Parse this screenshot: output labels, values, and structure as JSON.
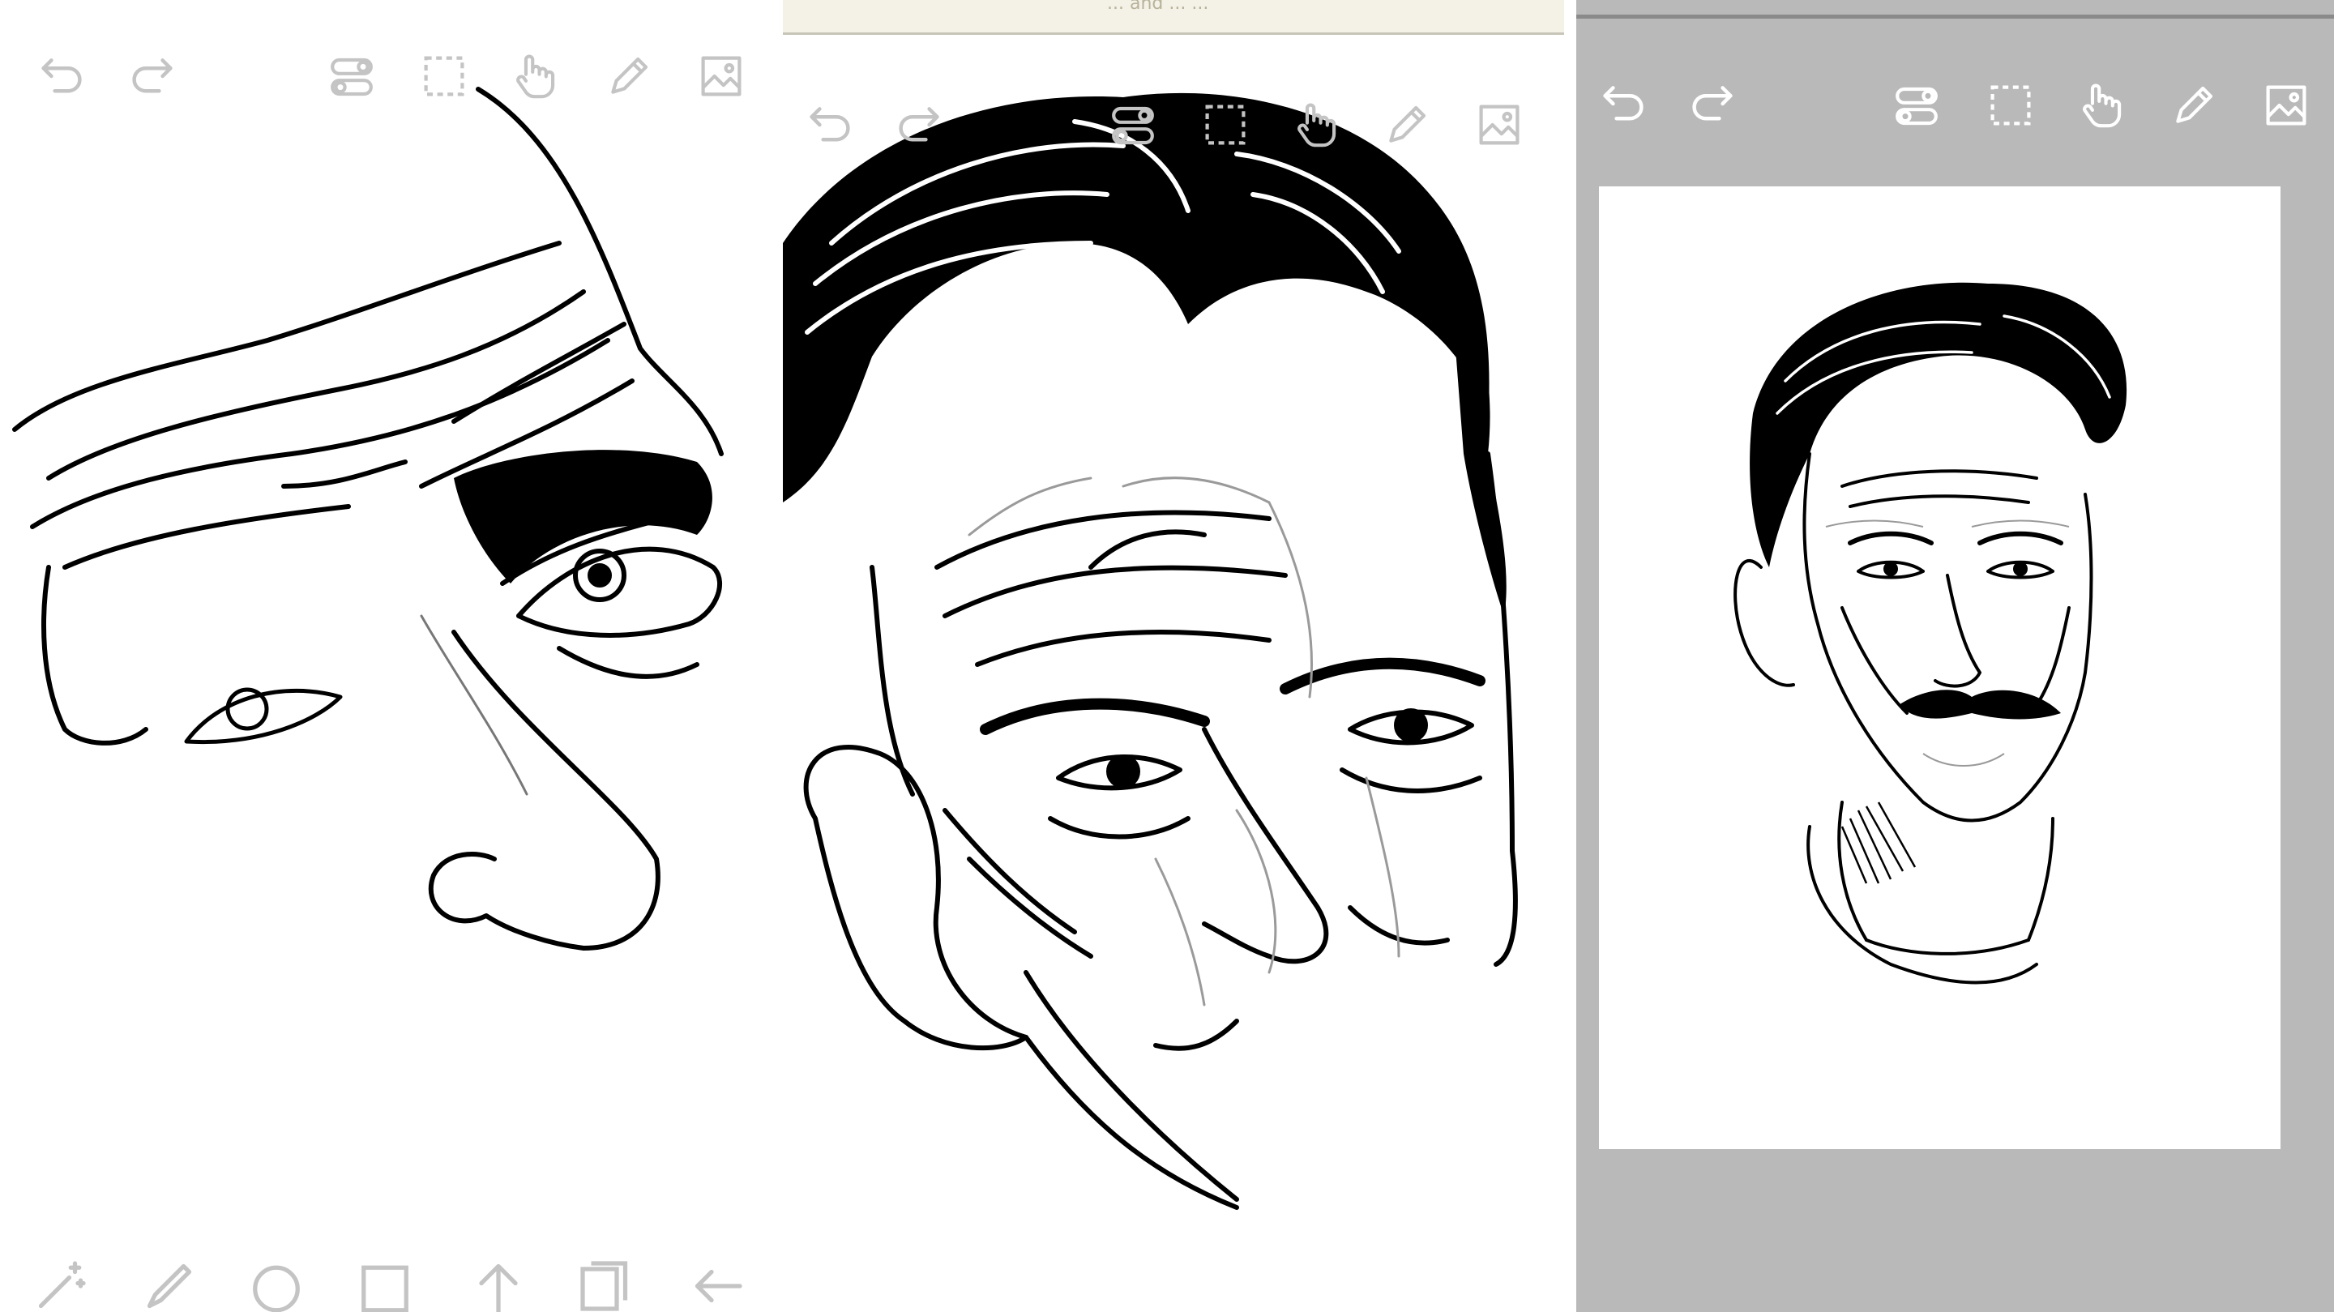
{
  "app": {
    "colors": {
      "icon_on_white": "#c4c4c4",
      "icon_on_gray": "#ffffff",
      "workspace_gray": "#b9b9b9",
      "ink": "#000000",
      "title_strip": "#f4f2e7"
    }
  },
  "panel_1": {
    "top_toolbar": [
      "undo-icon",
      "redo-icon",
      "toggle-settings-icon",
      "selection-icon",
      "hand-icon",
      "pencil-icon",
      "image-icon"
    ],
    "bottom_toolbar": [
      "magic-wand-icon",
      "brush-icon",
      "ellipse-icon",
      "rectangle-icon",
      "arrow-up-icon",
      "layers-icon",
      "back-arrow-icon"
    ]
  },
  "panel_2": {
    "window_title": "... and ... ...",
    "top_toolbar": [
      "undo-icon",
      "redo-icon",
      "toggle-settings-icon",
      "selection-icon",
      "hand-icon",
      "pencil-icon",
      "image-icon"
    ]
  },
  "panel_3": {
    "top_toolbar": [
      "undo-icon",
      "redo-icon",
      "toggle-settings-icon",
      "selection-icon",
      "hand-icon",
      "pencil-icon",
      "image-icon"
    ]
  }
}
